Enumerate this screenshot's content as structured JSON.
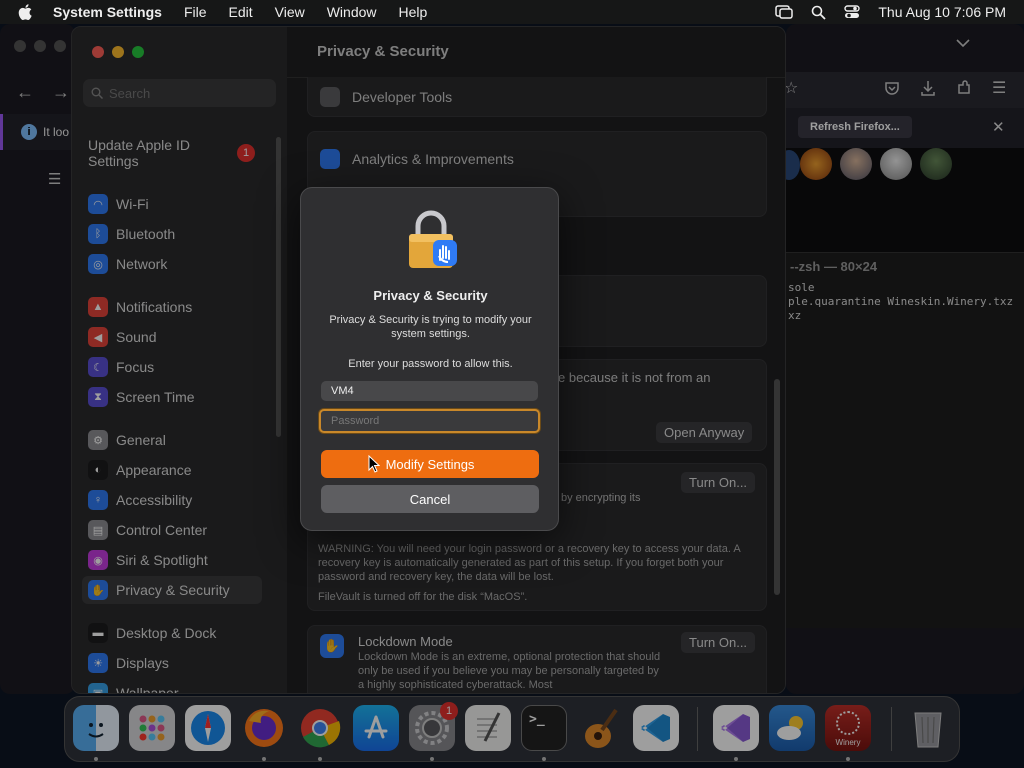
{
  "menubar": {
    "app": "System Settings",
    "items": [
      "File",
      "Edit",
      "View",
      "Window",
      "Help"
    ],
    "clock": "Thu Aug 10  7:06 PM"
  },
  "sidebar": {
    "search_placeholder": "Search",
    "apple_id": "Update Apple ID Settings",
    "apple_id_badge": "1",
    "items": [
      {
        "label": "Wi-Fi",
        "icon": "wifi-icon",
        "color": "#2f7bf5"
      },
      {
        "label": "Bluetooth",
        "icon": "bluetooth-icon",
        "color": "#2f7bf5"
      },
      {
        "label": "Network",
        "icon": "globe-icon",
        "color": "#2f7bf5"
      },
      {
        "label": "Notifications",
        "icon": "bell-icon",
        "color": "#e5443b"
      },
      {
        "label": "Sound",
        "icon": "speaker-icon",
        "color": "#e5443b"
      },
      {
        "label": "Focus",
        "icon": "moon-icon",
        "color": "#5b4fd6"
      },
      {
        "label": "Screen Time",
        "icon": "hourglass-icon",
        "color": "#5b4fd6"
      },
      {
        "label": "General",
        "icon": "gear-icon",
        "color": "#8e8e93"
      },
      {
        "label": "Appearance",
        "icon": "appearance-icon",
        "color": "#1c1c1e"
      },
      {
        "label": "Accessibility",
        "icon": "accessibility-icon",
        "color": "#2f7bf5"
      },
      {
        "label": "Control Center",
        "icon": "control-center-icon",
        "color": "#8e8e93"
      },
      {
        "label": "Siri & Spotlight",
        "icon": "siri-icon",
        "color": "#c53ce0"
      },
      {
        "label": "Privacy & Security",
        "icon": "hand-icon",
        "color": "#2f7bf5"
      },
      {
        "label": "Desktop & Dock",
        "icon": "dock-icon",
        "color": "#1c1c1e"
      },
      {
        "label": "Displays",
        "icon": "sun-icon",
        "color": "#2f7bf5"
      },
      {
        "label": "Wallpaper",
        "icon": "wallpaper-icon",
        "color": "#38a2e8"
      }
    ]
  },
  "main": {
    "title": "Privacy & Security",
    "developer_tools": "Developer Tools",
    "analytics": "Analytics & Improvements",
    "blocked_text": "e because it is not from an",
    "open_anyway": "Open Anyway",
    "turn_on": "Turn On...",
    "encrypt_text": "by encrypting its",
    "warning": "WARNING: You will need your login password or a recovery key to access your data. A recovery key is automatically generated as part of this setup. If you forget both your password and recovery key, the data will be lost.",
    "filevault_status": "FileVault is turned off for the disk “MacOS”.",
    "lockdown_title": "Lockdown Mode",
    "lockdown_desc": "Lockdown Mode is an extreme, optional protection that should only be used if you believe you may be personally targeted by a highly sophisticated cyberattack. Most",
    "lockdown_button": "Turn On..."
  },
  "dialog": {
    "title": "Privacy & Security",
    "message": "Privacy & Security is trying to modify your system settings.",
    "prompt": "Enter your password to allow this.",
    "username": "VM4",
    "password_placeholder": "Password",
    "primary_button": "Modify Settings",
    "cancel_button": "Cancel"
  },
  "firefox": {
    "tab_text": "It loo",
    "refresh_button": "Refresh Firefox..."
  },
  "terminal": {
    "title": "--zsh — 80×24",
    "lines": [
      "sole",
      "ple.quarantine Wineskin.Winery.txz",
      "xz"
    ]
  },
  "dock": {
    "settings_badge": "1",
    "winery_label": "Winery"
  }
}
